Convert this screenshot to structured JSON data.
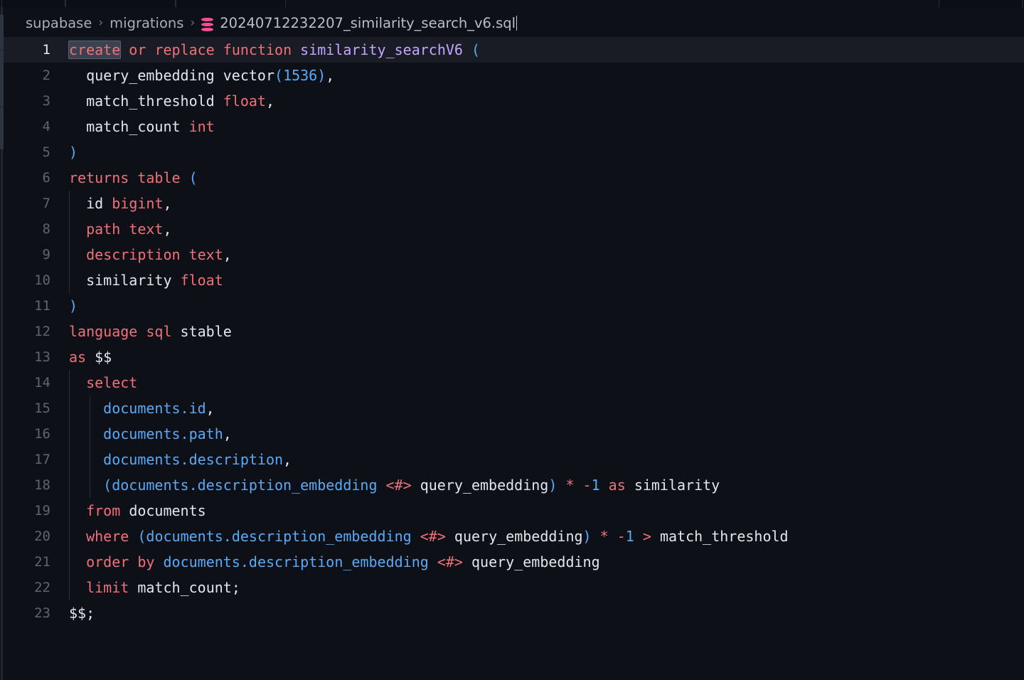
{
  "window": {
    "background": "#0d1017",
    "tab_fragments": [
      "tab-fragment-1",
      "tab-fragment-2",
      "tab-fragment-3",
      "tab-fragment-4"
    ]
  },
  "breadcrumb": {
    "root": "supabase",
    "folder": "migrations",
    "file": "20240712232207_similarity_search_v6.sql",
    "separator": "›",
    "icon": "database-icon",
    "icon_color": "#f4508b"
  },
  "editor": {
    "language": "sql",
    "active_line": 1,
    "selection_text": "create",
    "total_lines": 23,
    "colors": {
      "background": "#0d1017",
      "active_line": "#191c24",
      "keyword": "#f07178",
      "function": "#c3a6ff",
      "number": "#5ca9f5",
      "property": "#5ca9f5",
      "plain": "#e3e6ec",
      "gutter": "#5e6572",
      "gutter_active": "#e6e9ef",
      "indent_guide": "#2b303b",
      "selection": "#3a4150"
    },
    "lines": [
      {
        "n": "1",
        "indent": 0,
        "guides": 0,
        "active": true,
        "tokens": [
          {
            "t": "create",
            "c": "kw",
            "sel": true
          },
          {
            "t": " ",
            "c": "pl"
          },
          {
            "t": "or",
            "c": "kw"
          },
          {
            "t": " ",
            "c": "pl"
          },
          {
            "t": "replace",
            "c": "kw"
          },
          {
            "t": " ",
            "c": "pl"
          },
          {
            "t": "function",
            "c": "kw"
          },
          {
            "t": " ",
            "c": "pl"
          },
          {
            "t": "similarity_searchV6",
            "c": "fn"
          },
          {
            "t": " ",
            "c": "pl"
          },
          {
            "t": "(",
            "c": "punc"
          }
        ]
      },
      {
        "n": "2",
        "indent": 1,
        "guides": 0,
        "tokens": [
          {
            "t": "query_embedding",
            "c": "pl"
          },
          {
            "t": " ",
            "c": "pl"
          },
          {
            "t": "vector",
            "c": "pl"
          },
          {
            "t": "(",
            "c": "punc"
          },
          {
            "t": "1536",
            "c": "num"
          },
          {
            "t": ")",
            "c": "punc"
          },
          {
            "t": ",",
            "c": "com"
          }
        ]
      },
      {
        "n": "3",
        "indent": 1,
        "guides": 0,
        "tokens": [
          {
            "t": "match_threshold",
            "c": "pl"
          },
          {
            "t": " ",
            "c": "pl"
          },
          {
            "t": "float",
            "c": "typ"
          },
          {
            "t": ",",
            "c": "com"
          }
        ]
      },
      {
        "n": "4",
        "indent": 1,
        "guides": 0,
        "tokens": [
          {
            "t": "match_count",
            "c": "pl"
          },
          {
            "t": " ",
            "c": "pl"
          },
          {
            "t": "int",
            "c": "typ"
          }
        ]
      },
      {
        "n": "5",
        "indent": 0,
        "guides": 0,
        "tokens": [
          {
            "t": ")",
            "c": "punc"
          }
        ]
      },
      {
        "n": "6",
        "indent": 0,
        "guides": 0,
        "tokens": [
          {
            "t": "returns",
            "c": "kw"
          },
          {
            "t": " ",
            "c": "pl"
          },
          {
            "t": "table",
            "c": "kw"
          },
          {
            "t": " ",
            "c": "pl"
          },
          {
            "t": "(",
            "c": "punc"
          }
        ]
      },
      {
        "n": "7",
        "indent": 1,
        "guides": 1,
        "tokens": [
          {
            "t": "id",
            "c": "pl"
          },
          {
            "t": " ",
            "c": "pl"
          },
          {
            "t": "bigint",
            "c": "typ"
          },
          {
            "t": ",",
            "c": "com"
          }
        ]
      },
      {
        "n": "8",
        "indent": 1,
        "guides": 1,
        "tokens": [
          {
            "t": "path",
            "c": "typ"
          },
          {
            "t": " ",
            "c": "pl"
          },
          {
            "t": "text",
            "c": "typ"
          },
          {
            "t": ",",
            "c": "com"
          }
        ]
      },
      {
        "n": "9",
        "indent": 1,
        "guides": 1,
        "tokens": [
          {
            "t": "description",
            "c": "typ"
          },
          {
            "t": " ",
            "c": "pl"
          },
          {
            "t": "text",
            "c": "typ"
          },
          {
            "t": ",",
            "c": "com"
          }
        ]
      },
      {
        "n": "10",
        "indent": 1,
        "guides": 1,
        "tokens": [
          {
            "t": "similarity",
            "c": "pl"
          },
          {
            "t": " ",
            "c": "pl"
          },
          {
            "t": "float",
            "c": "typ"
          }
        ]
      },
      {
        "n": "11",
        "indent": 0,
        "guides": 0,
        "tokens": [
          {
            "t": ")",
            "c": "punc"
          }
        ]
      },
      {
        "n": "12",
        "indent": 0,
        "guides": 0,
        "tokens": [
          {
            "t": "language",
            "c": "kw"
          },
          {
            "t": " ",
            "c": "pl"
          },
          {
            "t": "sql",
            "c": "kw"
          },
          {
            "t": " ",
            "c": "pl"
          },
          {
            "t": "stable",
            "c": "pl"
          }
        ]
      },
      {
        "n": "13",
        "indent": 0,
        "guides": 0,
        "tokens": [
          {
            "t": "as",
            "c": "kw"
          },
          {
            "t": " ",
            "c": "pl"
          },
          {
            "t": "$$",
            "c": "pl"
          }
        ]
      },
      {
        "n": "14",
        "indent": 1,
        "guides": 1,
        "tokens": [
          {
            "t": "select",
            "c": "kw"
          }
        ]
      },
      {
        "n": "15",
        "indent": 2,
        "guides": 2,
        "tokens": [
          {
            "t": "documents.id",
            "c": "prop"
          },
          {
            "t": ",",
            "c": "com"
          }
        ]
      },
      {
        "n": "16",
        "indent": 2,
        "guides": 2,
        "tokens": [
          {
            "t": "documents.path",
            "c": "prop"
          },
          {
            "t": ",",
            "c": "com"
          }
        ]
      },
      {
        "n": "17",
        "indent": 2,
        "guides": 2,
        "tokens": [
          {
            "t": "documents.description",
            "c": "prop"
          },
          {
            "t": ",",
            "c": "com"
          }
        ]
      },
      {
        "n": "18",
        "indent": 2,
        "guides": 2,
        "tokens": [
          {
            "t": "(",
            "c": "punc"
          },
          {
            "t": "documents.description_embedding",
            "c": "prop"
          },
          {
            "t": " ",
            "c": "pl"
          },
          {
            "t": "<#>",
            "c": "op"
          },
          {
            "t": " ",
            "c": "pl"
          },
          {
            "t": "query_embedding",
            "c": "pl"
          },
          {
            "t": ")",
            "c": "punc"
          },
          {
            "t": " ",
            "c": "pl"
          },
          {
            "t": "*",
            "c": "op"
          },
          {
            "t": " ",
            "c": "pl"
          },
          {
            "t": "-",
            "c": "op"
          },
          {
            "t": "1",
            "c": "num"
          },
          {
            "t": " ",
            "c": "pl"
          },
          {
            "t": "as",
            "c": "kw"
          },
          {
            "t": " ",
            "c": "pl"
          },
          {
            "t": "similarity",
            "c": "pl"
          }
        ]
      },
      {
        "n": "19",
        "indent": 1,
        "guides": 1,
        "tokens": [
          {
            "t": "from",
            "c": "kw"
          },
          {
            "t": " ",
            "c": "pl"
          },
          {
            "t": "documents",
            "c": "pl"
          }
        ]
      },
      {
        "n": "20",
        "indent": 1,
        "guides": 1,
        "tokens": [
          {
            "t": "where",
            "c": "kw"
          },
          {
            "t": " ",
            "c": "pl"
          },
          {
            "t": "(",
            "c": "punc"
          },
          {
            "t": "documents.description_embedding",
            "c": "prop"
          },
          {
            "t": " ",
            "c": "pl"
          },
          {
            "t": "<#>",
            "c": "op"
          },
          {
            "t": " ",
            "c": "pl"
          },
          {
            "t": "query_embedding",
            "c": "pl"
          },
          {
            "t": ")",
            "c": "punc"
          },
          {
            "t": " ",
            "c": "pl"
          },
          {
            "t": "*",
            "c": "op"
          },
          {
            "t": " ",
            "c": "pl"
          },
          {
            "t": "-",
            "c": "op"
          },
          {
            "t": "1",
            "c": "num"
          },
          {
            "t": " ",
            "c": "pl"
          },
          {
            "t": ">",
            "c": "op"
          },
          {
            "t": " ",
            "c": "pl"
          },
          {
            "t": "match_threshold",
            "c": "pl"
          }
        ]
      },
      {
        "n": "21",
        "indent": 1,
        "guides": 1,
        "tokens": [
          {
            "t": "order",
            "c": "kw"
          },
          {
            "t": " ",
            "c": "pl"
          },
          {
            "t": "by",
            "c": "kw"
          },
          {
            "t": " ",
            "c": "pl"
          },
          {
            "t": "documents.description_embedding",
            "c": "prop"
          },
          {
            "t": " ",
            "c": "pl"
          },
          {
            "t": "<#>",
            "c": "op"
          },
          {
            "t": " ",
            "c": "pl"
          },
          {
            "t": "query_embedding",
            "c": "pl"
          }
        ]
      },
      {
        "n": "22",
        "indent": 1,
        "guides": 1,
        "tokens": [
          {
            "t": "limit",
            "c": "kw"
          },
          {
            "t": " ",
            "c": "pl"
          },
          {
            "t": "match_count",
            "c": "pl"
          },
          {
            "t": ";",
            "c": "com"
          }
        ]
      },
      {
        "n": "23",
        "indent": 0,
        "guides": 0,
        "tokens": [
          {
            "t": "$$",
            "c": "pl"
          },
          {
            "t": ";",
            "c": "com"
          }
        ]
      }
    ]
  }
}
